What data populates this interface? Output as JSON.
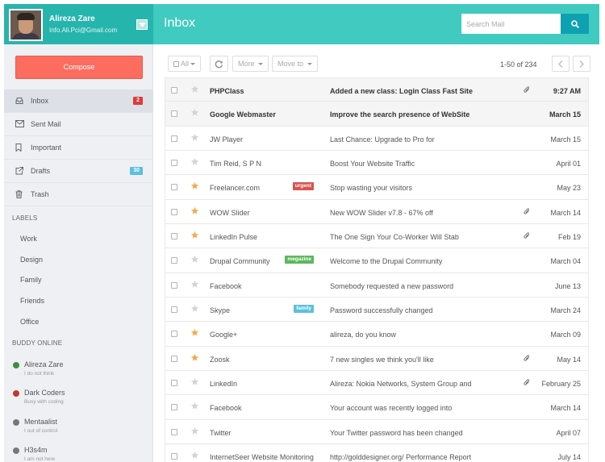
{
  "profile": {
    "name": "Alireza Zare",
    "email": "Info.Ali.Pci@Gmail.com"
  },
  "compose_label": "Compose",
  "nav": [
    {
      "label": "Inbox",
      "icon": "inbox-icon",
      "badge": "2",
      "badge_color": "#e03b3b",
      "active": true
    },
    {
      "label": "Sent Mail",
      "icon": "envelope-icon"
    },
    {
      "label": "Important",
      "icon": "bookmark-icon"
    },
    {
      "label": "Drafts",
      "icon": "external-link-icon",
      "badge": "30",
      "badge_color": "#5bc0de"
    },
    {
      "label": "Trash",
      "icon": "trash-icon"
    }
  ],
  "labels_heading": "LABELS",
  "labels": [
    "Work",
    "Design",
    "Family",
    "Friends",
    "Office"
  ],
  "buddy_heading": "BUDDY ONLINE",
  "buddies": [
    {
      "name": "Alireza Zare",
      "status": "I do not think",
      "color": "#3e8e41"
    },
    {
      "name": "Dark Coders",
      "status": "Busy with coding",
      "color": "#c0392b"
    },
    {
      "name": "Mentaalist",
      "status": "I out of control",
      "color": "#777777"
    },
    {
      "name": "H3s4m",
      "status": "I am not here",
      "color": "#777777"
    }
  ],
  "header": {
    "title": "Inbox",
    "search_placeholder": "Search Mail"
  },
  "toolbar": {
    "all_label": "All",
    "more_label": "More",
    "move_label": "Move to",
    "pager": "1-50 of 234"
  },
  "colors": {
    "accent": "#41cac0",
    "profile_bg": "#26b5ad",
    "compose": "#fc6c5f",
    "search_btn": "#0ea1b2",
    "star_on": "#f0ad4e"
  },
  "emails": [
    {
      "sender": "PHPClass",
      "subject": "Added a new class: Login Class Fast Site",
      "date": "9:27 AM",
      "starred": false,
      "attachment": true,
      "unread": true
    },
    {
      "sender": "Google Webmaster",
      "subject": "Improve the search presence of WebSite",
      "date": "March 15",
      "starred": false,
      "attachment": false,
      "unread": true
    },
    {
      "sender": "JW Player",
      "subject": "Last Chance: Upgrade to Pro for",
      "date": "March 15",
      "starred": false,
      "attachment": false
    },
    {
      "sender": "Tim Reid, S P N",
      "subject": "Boost Your Website Traffic",
      "date": "April 01",
      "starred": false,
      "attachment": false
    },
    {
      "sender": "Freelancer.com",
      "subject": "Stop wasting your visitors",
      "date": "May 23",
      "starred": true,
      "attachment": false,
      "tag": "urgent",
      "tag_color": "#d9534f"
    },
    {
      "sender": "WOW Slider",
      "subject": "New WOW Slider v7.8 - 67% off",
      "date": "March 14",
      "starred": true,
      "attachment": true
    },
    {
      "sender": "LinkedIn Pulse",
      "subject": "The One Sign Your Co-Worker Will Stab",
      "date": "Feb 19",
      "starred": true,
      "attachment": true
    },
    {
      "sender": "Drupal Community",
      "subject": "Welcome to the Drupal Community",
      "date": "March 04",
      "starred": false,
      "attachment": false,
      "tag": "megazine",
      "tag_color": "#5cb85c"
    },
    {
      "sender": "Facebook",
      "subject": "Somebody requested a new password",
      "date": "June 13",
      "starred": false,
      "attachment": false
    },
    {
      "sender": "Skype",
      "subject": "Password successfully changed",
      "date": "March 24",
      "starred": false,
      "attachment": false,
      "tag": "family",
      "tag_color": "#5bc0de"
    },
    {
      "sender": "Google+",
      "subject": "alireza, do you know",
      "date": "March 09",
      "starred": true,
      "attachment": false
    },
    {
      "sender": "Zoosk",
      "subject": "7 new singles we think you'll like",
      "date": "May 14",
      "starred": true,
      "attachment": true
    },
    {
      "sender": "LinkedIn",
      "subject": "Alireza: Nokia Networks, System Group and",
      "date": "February 25",
      "starred": false,
      "attachment": true
    },
    {
      "sender": "Facebook",
      "subject": "Your account was recently logged into",
      "date": "March 14",
      "starred": false,
      "attachment": false
    },
    {
      "sender": "Twitter",
      "subject": "Your Twitter password has been changed",
      "date": "April 07",
      "starred": false,
      "attachment": false
    },
    {
      "sender": "InternetSeer Website Monitoring",
      "subject": "http://golddesigner.org/ Performance Report",
      "date": "July 14",
      "starred": false,
      "attachment": false
    }
  ]
}
